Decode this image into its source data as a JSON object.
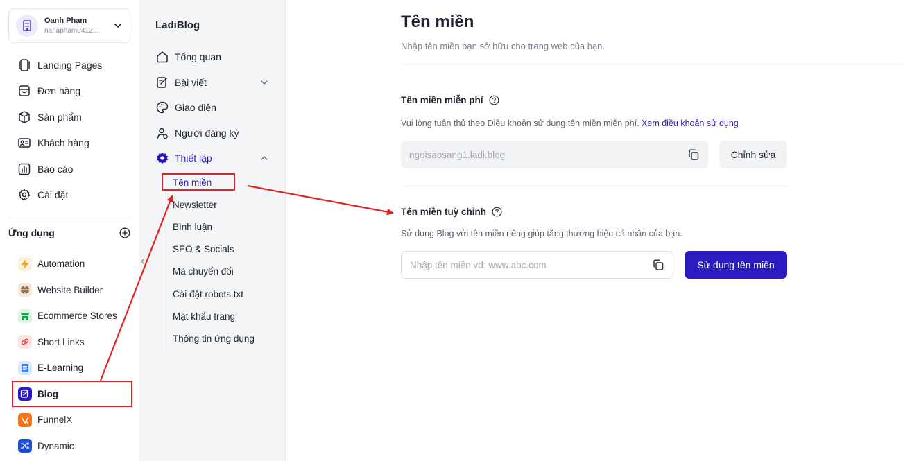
{
  "account": {
    "name": "Oanh Phạm",
    "email": "nanapham0412..."
  },
  "main_menu": [
    {
      "label": "Landing Pages",
      "icon": "landing-pages-icon"
    },
    {
      "label": "Đơn hàng",
      "icon": "orders-icon"
    },
    {
      "label": "Sản phẩm",
      "icon": "box-icon"
    },
    {
      "label": "Khách hàng",
      "icon": "contact-card-icon"
    },
    {
      "label": "Báo cáo",
      "icon": "report-icon"
    },
    {
      "label": "Cài đặt",
      "icon": "gear-icon"
    }
  ],
  "apps": {
    "title": "Ứng dụng",
    "items": [
      {
        "label": "Automation",
        "icon": "lightning-icon",
        "color": "#f59e0b"
      },
      {
        "label": "Website Builder",
        "icon": "globe-icon",
        "color": "#9a6b4a"
      },
      {
        "label": "Ecommerce Stores",
        "icon": "store-icon",
        "color": "#16a34a"
      },
      {
        "label": "Short Links",
        "icon": "link-icon",
        "color": "#ef4444"
      },
      {
        "label": "E-Learning",
        "icon": "book-icon",
        "color": "#3b82f6"
      },
      {
        "label": "Blog",
        "icon": "blog-icon",
        "color": "#2d1bc2",
        "active": true
      },
      {
        "label": "FunnelX",
        "icon": "funnelx-icon",
        "color": "#f97316"
      },
      {
        "label": "Dynamic",
        "icon": "shuffle-icon",
        "color": "#1d4ed8"
      }
    ]
  },
  "blog_nav": {
    "title": "LadiBlog",
    "items": [
      {
        "label": "Tổng quan",
        "icon": "home-icon"
      },
      {
        "label": "Bài viết",
        "icon": "edit-icon"
      },
      {
        "label": "Giao diện",
        "icon": "palette-icon"
      },
      {
        "label": "Người đăng ký",
        "icon": "users-icon"
      },
      {
        "label": "Thiết lập",
        "icon": "gear-icon"
      }
    ],
    "settings_children": [
      "Tên miền",
      "Newsletter",
      "Bình luận",
      "SEO & Socials",
      "Mã chuyển đổi",
      "Cài đặt robots.txt",
      "Mật khẩu trang",
      "Thông tin ứng dụng"
    ]
  },
  "page": {
    "title": "Tên miền",
    "subtitle": "Nhập tên miền bạn sở hữu cho trang web của bạn."
  },
  "free_domain": {
    "title": "Tên miền miễn phí",
    "desc": "Vui lòng tuân thủ theo Điều khoản sử dụng tên miền miễn phí.",
    "link": "Xem điều khoản sử dụng",
    "value": "ngoisaosang1.ladi.blog",
    "edit_button": "Chỉnh sửa"
  },
  "custom_domain": {
    "title": "Tên miền tuỳ chỉnh",
    "desc": "Sử dụng Blog với tên miền riêng giúp tăng thương hiệu cá nhân của bạn.",
    "placeholder": "Nhập tên miền vd: www.abc.com",
    "use_button": "Sử dụng tên miền"
  },
  "colors": {
    "primary": "#2d1bc2",
    "annotation": "#e02424"
  }
}
